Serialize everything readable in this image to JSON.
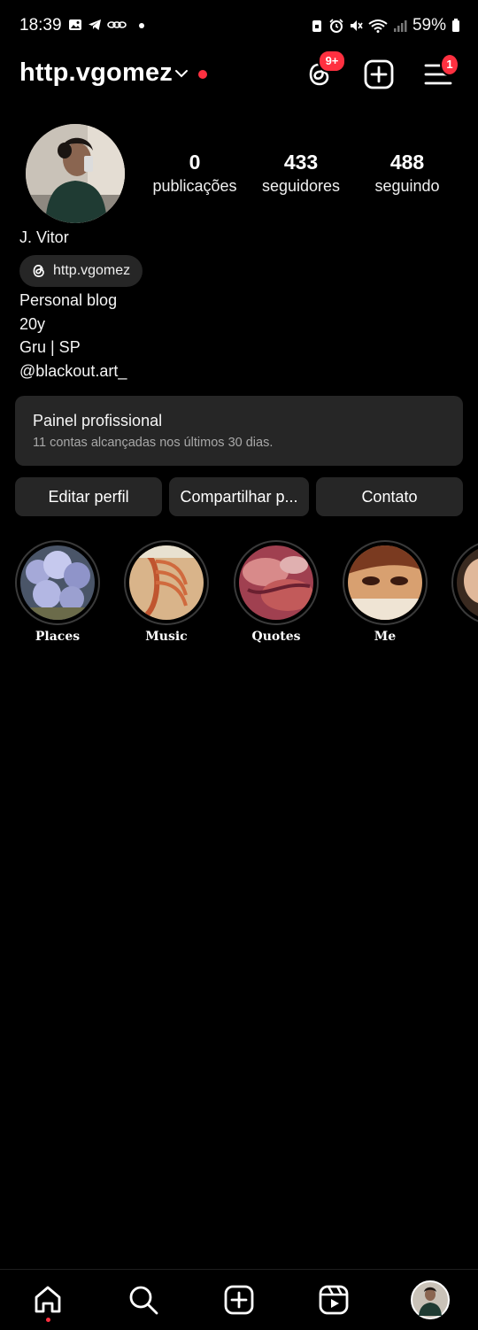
{
  "status_bar": {
    "time": "18:39",
    "battery": "59%",
    "left_icons": [
      "gallery-icon",
      "telegram-icon",
      "vpn-icon",
      "dot-icon"
    ],
    "right_icons": [
      "lock-icon",
      "alarm-icon",
      "mute-icon",
      "wifi-icon",
      "signal-icon",
      "battery-icon"
    ]
  },
  "header": {
    "username": "http.vgomez",
    "threads_badge": "9+",
    "menu_badge": "1"
  },
  "profile": {
    "stats": [
      {
        "value": "0",
        "label": "publicações"
      },
      {
        "value": "433",
        "label": "seguidores"
      },
      {
        "value": "488",
        "label": "seguindo"
      }
    ],
    "full_name": "J. Vitor",
    "threads_handle": "http.vgomez",
    "bio_lines": [
      "Personal blog",
      "20y",
      "Gru | SP",
      "@blackout.art_"
    ]
  },
  "professional_panel": {
    "title": "Painel profissional",
    "subtitle": "11 contas alcançadas nos últimos 30 dias."
  },
  "actions": {
    "edit": "Editar perfil",
    "share": "Compartilhar p...",
    "contact": "Contato"
  },
  "highlights": [
    {
      "label": "Places"
    },
    {
      "label": "Music"
    },
    {
      "label": "Quotes"
    },
    {
      "label": "Me"
    },
    {
      "label": ""
    }
  ],
  "bottom_nav": [
    "home-icon",
    "search-icon",
    "create-icon",
    "reels-icon",
    "profile-avatar"
  ],
  "colors": {
    "background": "#000000",
    "surface": "#262626",
    "badge": "#ff3040",
    "secondary_text": "#a8a8a8"
  }
}
